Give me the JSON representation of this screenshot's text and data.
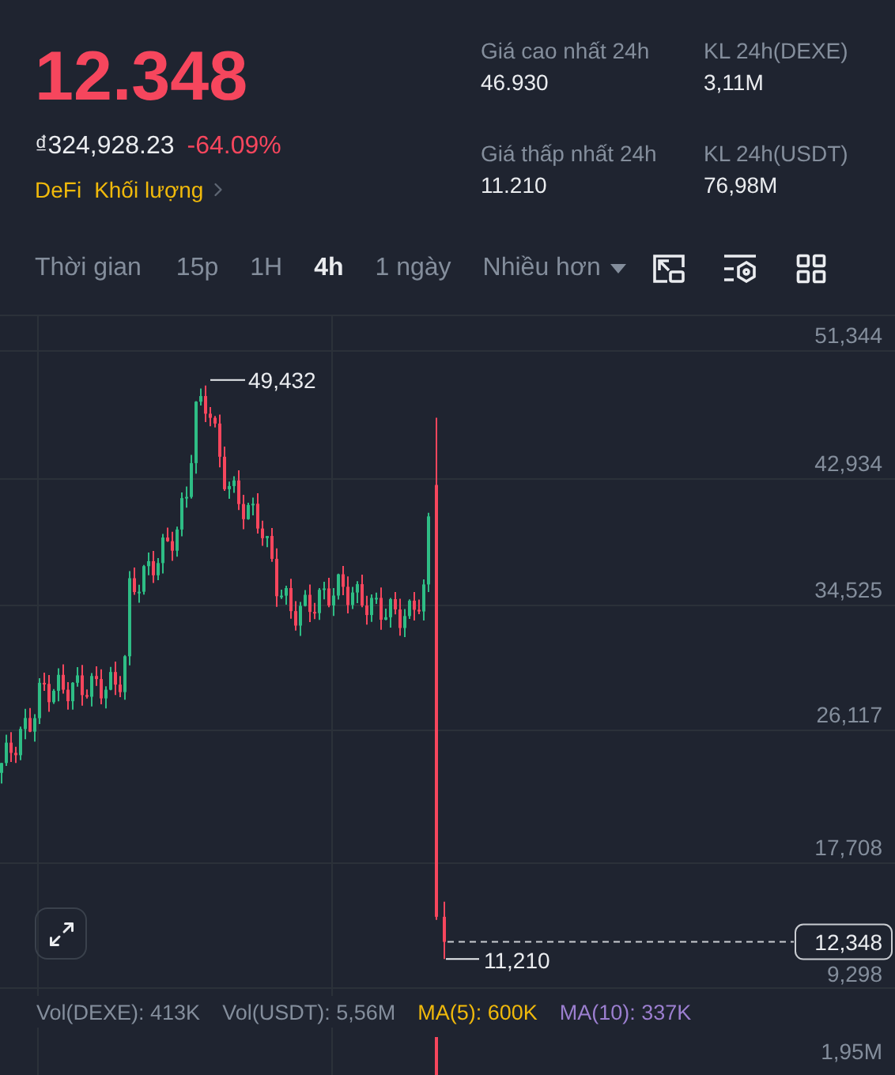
{
  "price": {
    "last": "12.348",
    "fiat": "₫324,928.23",
    "change": "-64.09%"
  },
  "tags": [
    {
      "label": "DeFi",
      "kind": "tag"
    },
    {
      "label": "Khối lượng",
      "kind": "link"
    }
  ],
  "stats": [
    {
      "label": "Giá cao nhất 24h",
      "value": "46.930"
    },
    {
      "label": "KL 24h(DEXE)",
      "value": "3,11M"
    },
    {
      "label": "Giá thấp nhất 24h",
      "value": "11.210"
    },
    {
      "label": "KL 24h(USDT)",
      "value": "76,98M"
    }
  ],
  "toolbar": {
    "intervals": [
      {
        "label": "Thời gian",
        "selected": false
      },
      {
        "label": "15p",
        "selected": false
      },
      {
        "label": "1H",
        "selected": false
      },
      {
        "label": "4h",
        "selected": true
      },
      {
        "label": "1 ngày",
        "selected": false
      }
    ],
    "more": "Nhiều hơn"
  },
  "chart": {
    "price_axis": [
      "51,344",
      "42,934",
      "34,525",
      "26,117",
      "17,708",
      "9,298"
    ],
    "high_label": "49,432",
    "low_label": "11,210",
    "last_price": "12,348"
  },
  "volume": {
    "items": [
      {
        "text": "Vol(DEXE): 413K",
        "color": "#848e9c"
      },
      {
        "text": "Vol(USDT): 5,56M",
        "color": "#848e9c"
      },
      {
        "text": "MA(5): 600K",
        "color": "#f0b90b"
      },
      {
        "text": "MA(10): 337K",
        "color": "#9c7fd0"
      }
    ],
    "axis": "1,95M"
  }
}
